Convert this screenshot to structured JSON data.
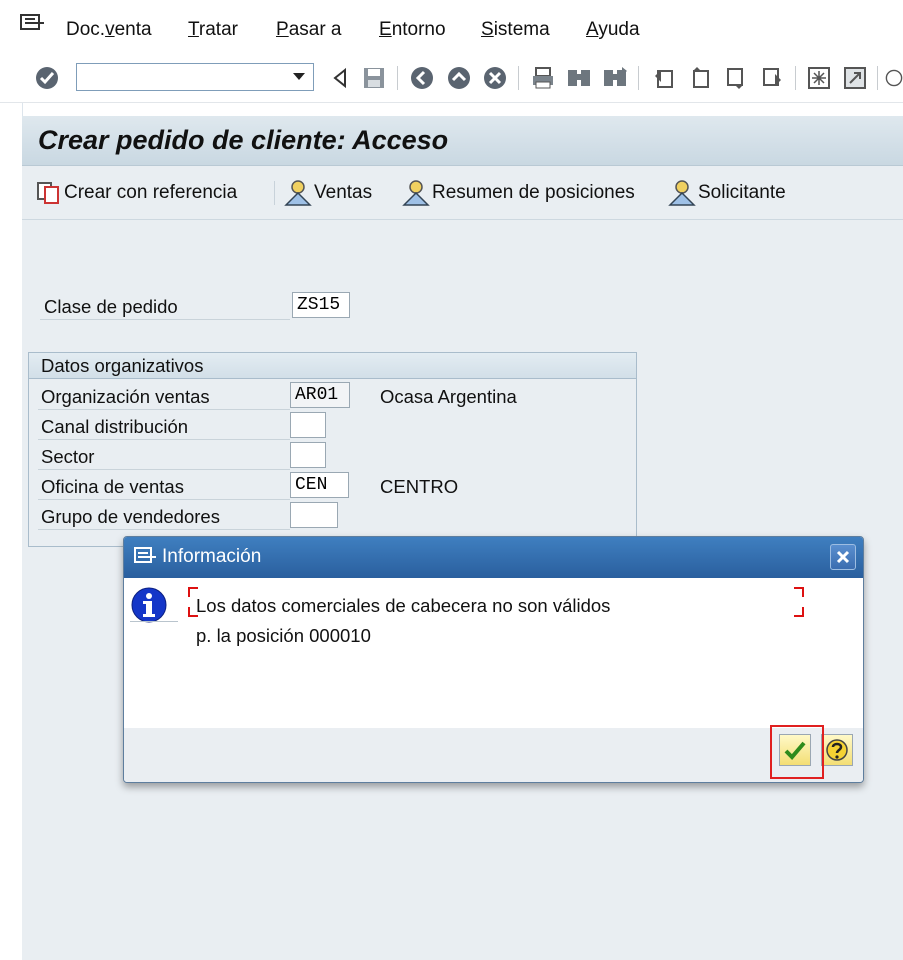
{
  "menubar": {
    "items": [
      {
        "pre": "Doc.",
        "u": "v",
        "post": "enta"
      },
      {
        "pre": "",
        "u": "T",
        "post": "ratar"
      },
      {
        "pre": "",
        "u": "P",
        "post": "asar a"
      },
      {
        "pre": "",
        "u": "E",
        "post": "ntorno"
      },
      {
        "pre": "",
        "u": "S",
        "post": "istema"
      },
      {
        "pre": "",
        "u": "A",
        "post": "yuda"
      }
    ]
  },
  "toolbar": {
    "command_field_value": "",
    "icons": [
      "enter-icon",
      "back-icon",
      "save-icon",
      "back-nav-icon",
      "exit-icon",
      "cancel-icon",
      "print-icon",
      "find-icon",
      "find-next-icon",
      "first-page-icon",
      "previous-page-icon",
      "next-page-icon",
      "last-page-icon",
      "create-session-icon",
      "shortcut-icon",
      "help-icon"
    ]
  },
  "title": "Crear pedido de cliente: Acceso",
  "app_toolbar": {
    "create_with_reference": "Crear con referencia",
    "sales": "Ventas",
    "item_overview": "Resumen de posiciones",
    "ordering_party": "Solicitante"
  },
  "form": {
    "order_type_label": "Clase de pedido",
    "order_type_value": "ZS15",
    "org_group_title": "Datos organizativos",
    "sales_org_label": "Organización ventas",
    "sales_org_value": "AR01",
    "sales_org_desc": "Ocasa Argentina",
    "distribution_channel_label": "Canal distribución",
    "distribution_channel_value": "",
    "division_label": "Sector",
    "division_value": "",
    "sales_office_label": "Oficina de ventas",
    "sales_office_value": "CEN",
    "sales_office_desc": "CENTRO",
    "sales_group_label": "Grupo de vendedores",
    "sales_group_value": ""
  },
  "dialog": {
    "title": "Información",
    "message_line1": "Los datos comerciales de cabecera no son válidos",
    "message_line2": "p. la posición 000010"
  },
  "colors": {
    "dialog_title_bar": "#2f6aae",
    "main_background": "#e9eef2",
    "highlight_border": "#e02020"
  }
}
